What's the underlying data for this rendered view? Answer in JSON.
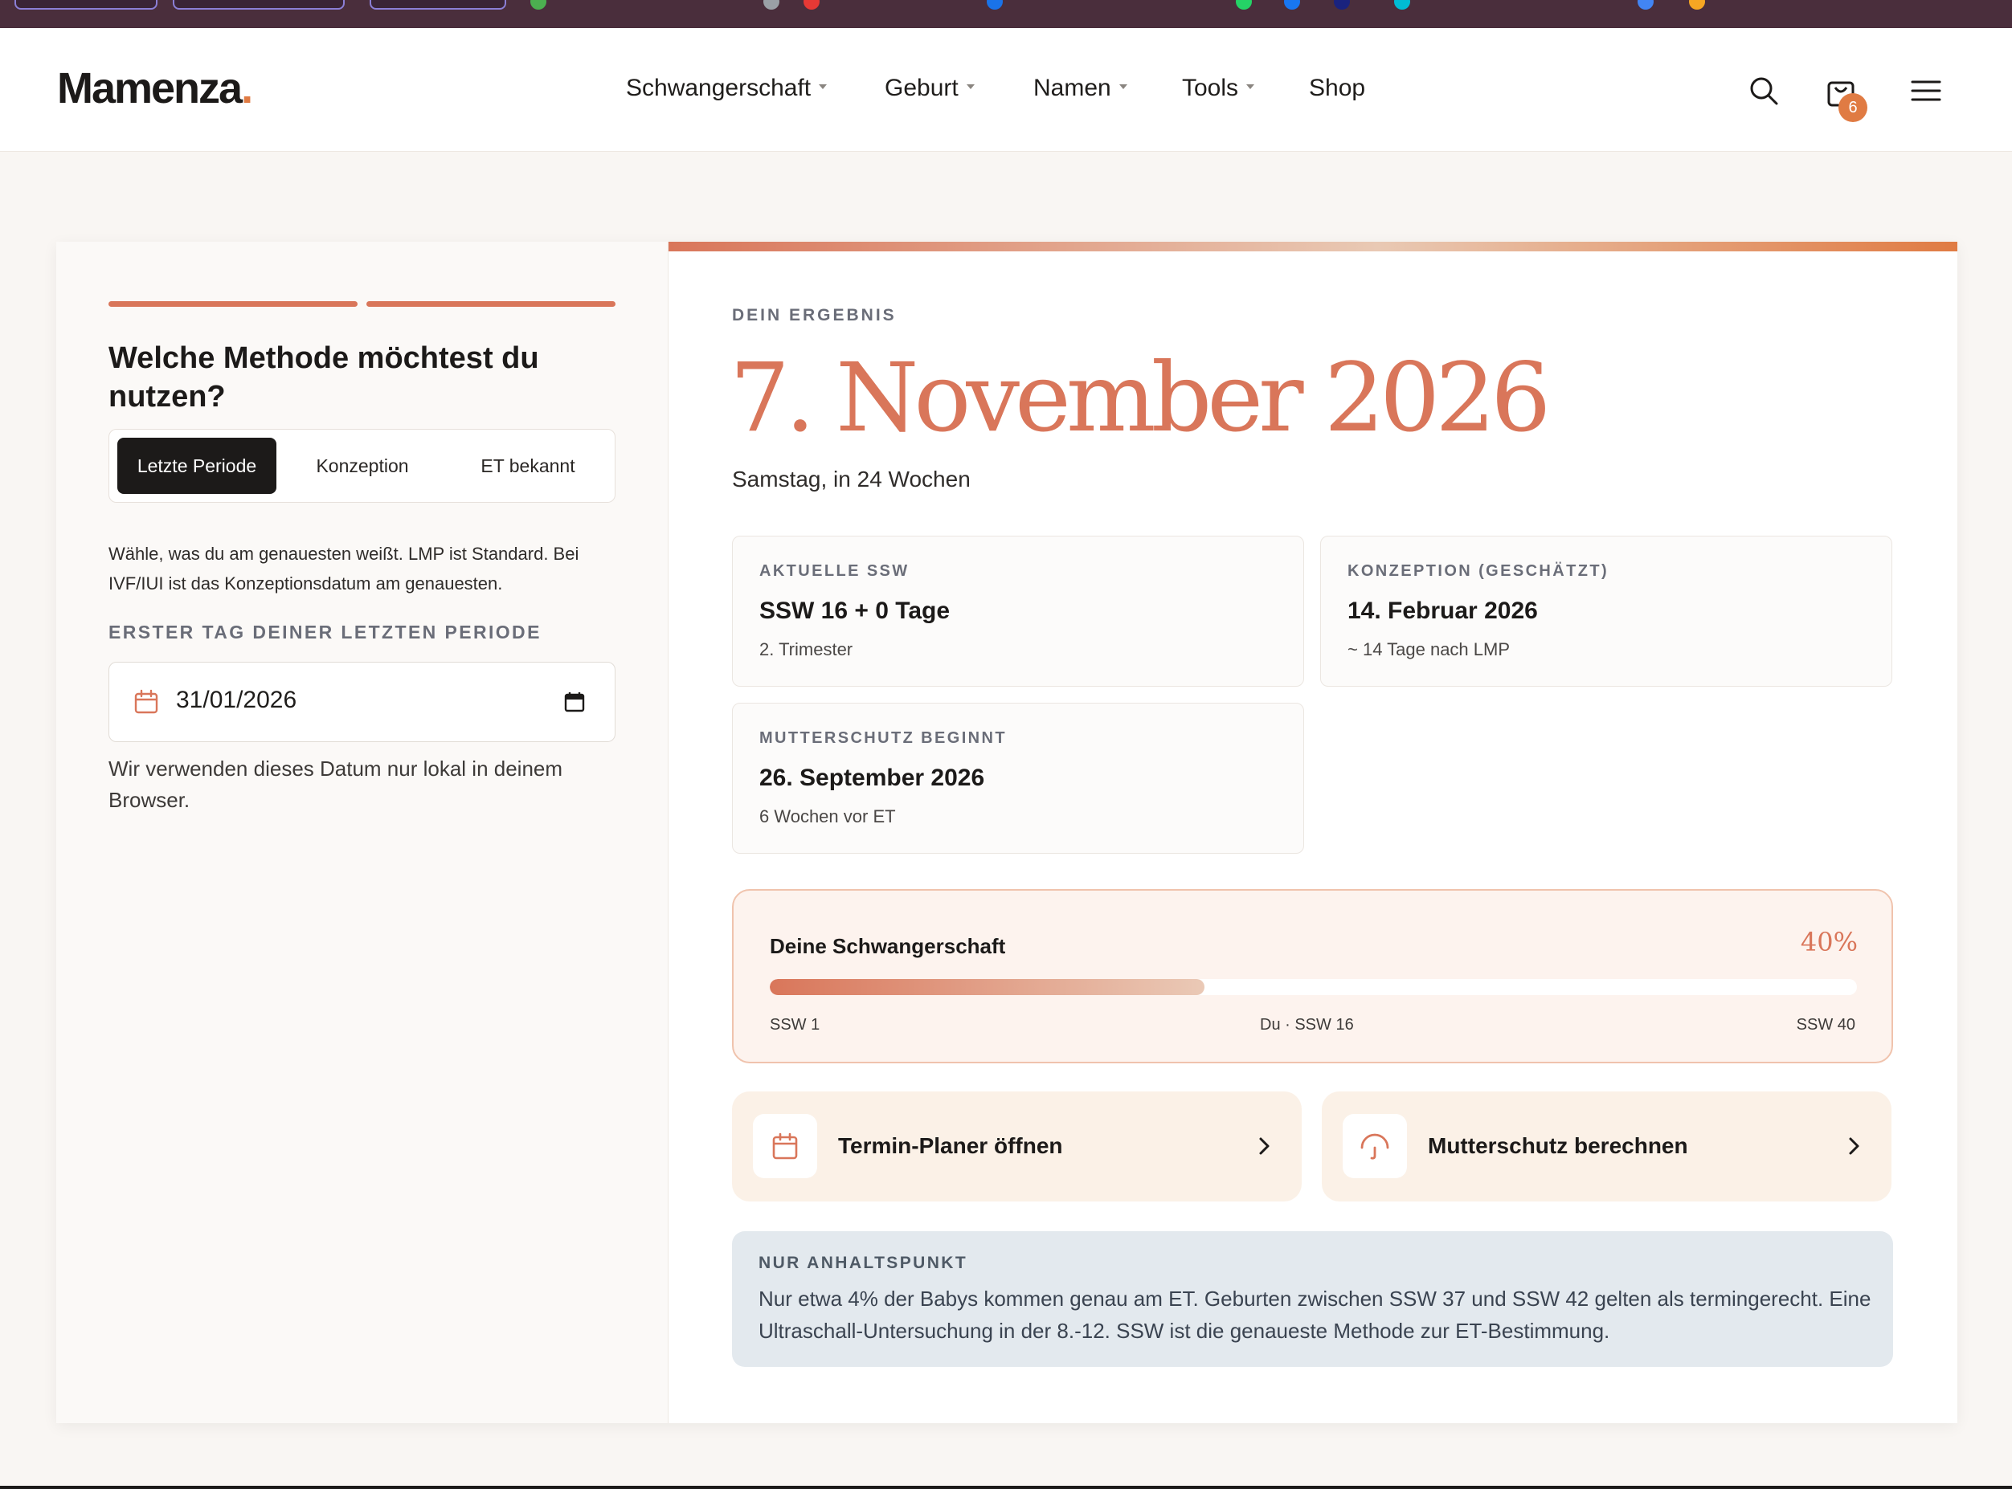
{
  "brand": {
    "name": "Mamenza",
    "dot": ".",
    "accent_color": "#e07b43",
    "primary_color": "#d9765a"
  },
  "nav": {
    "items": [
      {
        "label": "Schwangerschaft",
        "has_dropdown": true
      },
      {
        "label": "Geburt",
        "has_dropdown": true
      },
      {
        "label": "Namen",
        "has_dropdown": true
      },
      {
        "label": "Tools",
        "has_dropdown": true
      },
      {
        "label": "Shop",
        "has_dropdown": false
      }
    ],
    "cart_count": "6",
    "icons": [
      "search-icon",
      "shopping-bag-icon",
      "hamburger-menu-icon"
    ]
  },
  "form": {
    "question": "Welche Methode möchtest du nutzen?",
    "methods": [
      "Letzte Periode",
      "Konzeption",
      "ET bekannt"
    ],
    "active_method": "Letzte Periode",
    "help_text": "Wähle, was du am genauesten weißt. LMP ist Standard. Bei IVF/IUI ist das Konzeptionsdatum am genauesten.",
    "field_label": "ERSTER TAG DEINER LETZTEN PERIODE",
    "date_value": "31/01/2026",
    "privacy_note": "Wir verwenden dieses Datum nur lokal in deinem Browser."
  },
  "result": {
    "label": "DEIN ERGEBNIS",
    "date": "7. November 2026",
    "sub": "Samstag, in 24 Wochen",
    "boxes": [
      {
        "label": "AKTUELLE SSW",
        "value": "SSW 16 + 0 Tage",
        "sub": "2. Trimester"
      },
      {
        "label": "KONZEPTION (GESCHÄTZT)",
        "value": "14. Februar 2026",
        "sub": "~ 14 Tage nach LMP"
      },
      {
        "label": "MUTTERSCHUTZ BEGINNT",
        "value": "26. September 2026",
        "sub": "6 Wochen vor ET"
      }
    ]
  },
  "progress": {
    "title": "Deine Schwangerschaft",
    "percent_label": "40%",
    "fraction": 0.4,
    "ticks": {
      "start": "SSW 1",
      "current": "Du · SSW 16",
      "end": "SSW 40"
    }
  },
  "actions": [
    {
      "label": "Termin-Planer öffnen",
      "icon": "calendar-icon"
    },
    {
      "label": "Mutterschutz berechnen",
      "icon": "umbrella-icon"
    }
  ],
  "notice": {
    "label": "NUR ANHALTSPUNKT",
    "text": "Nur etwa 4% der Babys kommen genau am ET. Geburten zwischen SSW 37 und SSW 42 gelten als termingerecht. Eine Ultraschall-Untersuchung in der 8.-12. SSW ist die genaueste Methode zur ET-Bestimmung."
  }
}
